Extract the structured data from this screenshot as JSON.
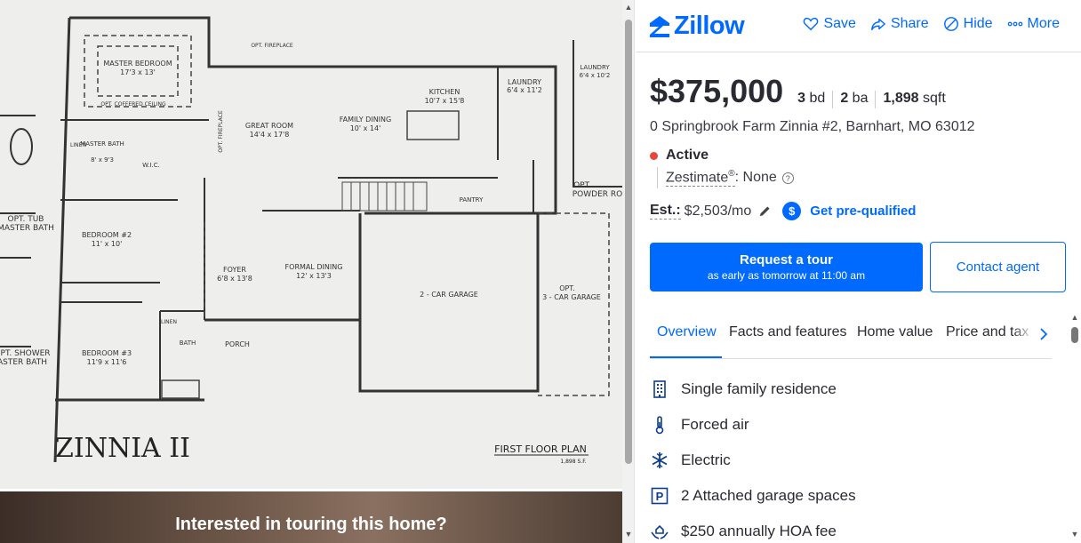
{
  "photo": {
    "plan_labels": {
      "title": "ZINNIA II",
      "first_floor": "FIRST FLOOR PLAN",
      "sqft": "1,898 S.F.",
      "master_bedroom": "MASTER BEDROOM",
      "master_bedroom_dim": "17'3 x 13'",
      "opt_coffered": "OPT. COFFERED CEILING",
      "great_room": "GREAT ROOM",
      "great_room_dim": "14'4 x 17'8",
      "family_dining": "FAMILY DINING",
      "family_dining_dim": "10' x 14'",
      "kitchen": "KITCHEN",
      "kitchen_dim": "10'7 x 15'8",
      "laundry": "LAUNDRY",
      "laundry_dim": "6'4 x 11'2",
      "bedroom2": "BEDROOM #2",
      "bedroom2_dim": "11' x 10'",
      "bedroom3": "BEDROOM #3",
      "bedroom3_dim": "11'9 x 11'6",
      "foyer": "FOYER",
      "foyer_dim": "6'8 x 13'8",
      "formal_dining": "FORMAL DINING",
      "formal_dining_dim": "12' x 13'3",
      "garage2": "2 - CAR GARAGE",
      "garage3_a": "OPT.",
      "garage3_b": "3 - CAR GARAGE",
      "porch": "PORCH",
      "bath": "BATH",
      "master_bath": "MASTER BATH",
      "master_bath_dim": "8' x 9'3",
      "wic": "W.I.C.",
      "pantry": "PANTRY",
      "opt_fireplace": "OPT. FIREPLACE",
      "opt_fireplace2": "OPT. FIREPLACE",
      "opt_tub": "OPT. TUB",
      "opt_tub2": "MASTER BATH",
      "opt_shower": "OPT. SHOWER",
      "opt_shower2": "ASTER BATH",
      "opt_powder": "OPT.",
      "opt_powder2": "POWDER RO",
      "laundry_r": "LAUNDRY",
      "laundry_r_dim": "6'4 x 10'2",
      "linen": "LINEN",
      "linen2": "LINEN"
    },
    "touring_text": "Interested in touring this home?"
  },
  "header": {
    "logo_text": "Zillow",
    "actions": {
      "save": "Save",
      "share": "Share",
      "hide": "Hide",
      "more": "More"
    }
  },
  "listing": {
    "price": "$375,000",
    "beds_num": "3",
    "beds_unit": "bd",
    "baths_num": "2",
    "baths_unit": "ba",
    "sqft_num": "1,898",
    "sqft_unit": "sqft",
    "address": "0 Springbrook Farm Zinnia #2, Barnhart, MO 63012",
    "status": "Active",
    "zestimate_label": "Zestimate",
    "zestimate_sup": "®",
    "zestimate_value": ": None",
    "est_label": "Est.:",
    "est_value": "$2,503/mo",
    "prequal": "Get pre-qualified"
  },
  "buttons": {
    "tour_line1": "Request a tour",
    "tour_line2": "as early as tomorrow at 11:00 am",
    "contact": "Contact agent"
  },
  "tabs": [
    "Overview",
    "Facts and features",
    "Home value",
    "Price and tax h"
  ],
  "features": [
    {
      "icon": "building-icon",
      "text": "Single family residence"
    },
    {
      "icon": "thermometer-icon",
      "text": "Forced air"
    },
    {
      "icon": "snowflake-icon",
      "text": "Electric"
    },
    {
      "icon": "parking-icon",
      "text": "2 Attached garage spaces"
    },
    {
      "icon": "hoa-hands-icon",
      "text": "$250 annually HOA fee"
    }
  ],
  "colors": {
    "brand": "#006aff",
    "status_active": "#e8453c",
    "text": "#2a2a33"
  }
}
